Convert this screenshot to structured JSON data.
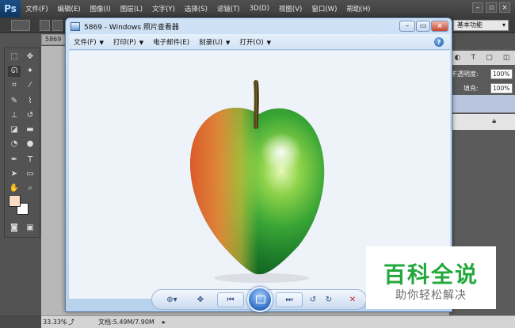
{
  "photoshop": {
    "logo": "Ps",
    "menu": [
      "文件(F)",
      "编辑(E)",
      "图像(I)",
      "图层(L)",
      "文字(Y)",
      "选择(S)",
      "滤镜(T)",
      "3D(D)",
      "视图(V)",
      "窗口(W)",
      "帮助(H)"
    ],
    "workspace": "基本功能",
    "document_tab": "5869",
    "panel": {
      "opacity_label": "不透明度:",
      "opacity_value": "100%",
      "fill_label": "填充:",
      "fill_value": "100%"
    },
    "status": {
      "zoom": "33.33%",
      "doc_size": "文档:5.49M/7.90M"
    },
    "foreground_color": "#fbdcc2",
    "background_color": "#ffffff"
  },
  "viewer": {
    "title": "5869 - Windows 照片查看器",
    "menu": [
      {
        "label": "文件(F)"
      },
      {
        "label": "打印(P)"
      },
      {
        "label": "电子邮件(E)"
      },
      {
        "label": "刻录(U)"
      },
      {
        "label": "打开(O)"
      }
    ],
    "help_icon": "?",
    "image_subject": "apple-icon"
  },
  "watermark": {
    "title": "百科全说",
    "subtitle": "助你轻松解决"
  }
}
